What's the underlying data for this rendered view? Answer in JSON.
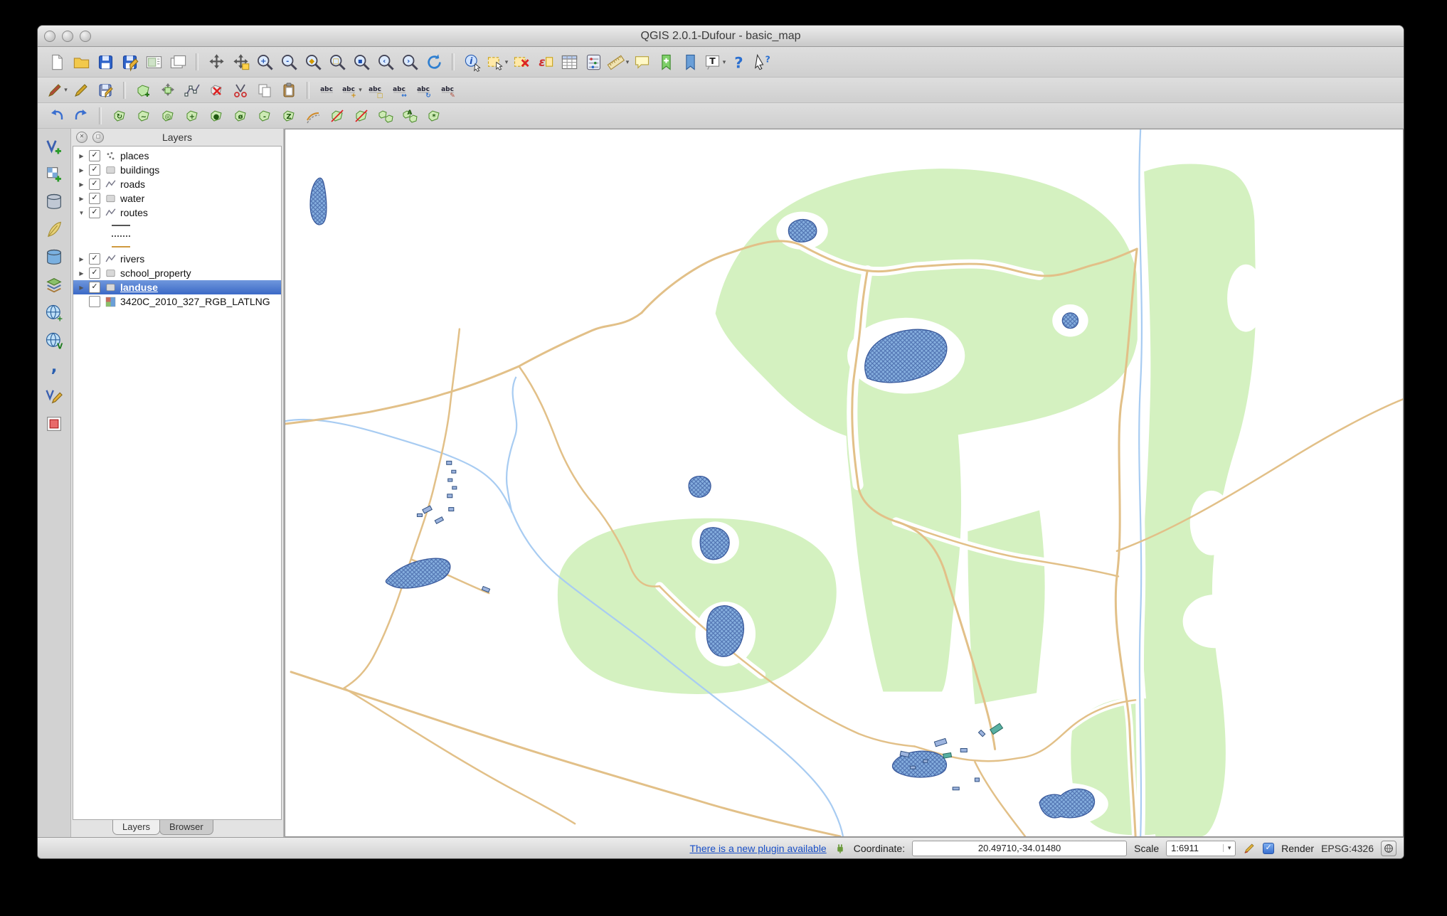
{
  "window": {
    "title": "QGIS 2.0.1-Dufour - basic_map",
    "buttons": [
      "close-button",
      "minimize-button",
      "zoom-button"
    ]
  },
  "colors": {
    "sel": "#3b69c6",
    "link": "#1a50c8",
    "landuse": "#d4f1c0",
    "water": "#85aede",
    "waterline": "#3a5a9c",
    "road": "#e2c088",
    "river": "#a8ccf2",
    "bld": "#9db4de",
    "bldline": "#2f4f7f",
    "school": "#58b0a2"
  },
  "toolbars": {
    "row1": [
      {
        "name": "new-project",
        "k": "page"
      },
      {
        "name": "open-project",
        "k": "folder"
      },
      {
        "name": "save-project",
        "k": "floppy"
      },
      {
        "name": "save-project-as",
        "k": "floppyPen"
      },
      {
        "name": "new-print-composer",
        "k": "composer"
      },
      {
        "name": "composer-manager",
        "k": "composerMgr"
      },
      {
        "sep": true
      },
      {
        "name": "pan-map",
        "k": "pan"
      },
      {
        "name": "pan-map-to-selection",
        "k": "panSel"
      },
      {
        "name": "zoom-in",
        "k": "mag",
        "b": "+"
      },
      {
        "name": "zoom-out",
        "k": "mag",
        "b": "-"
      },
      {
        "name": "zoom-full",
        "k": "mag",
        "b": "◆",
        "c": "#d29a00"
      },
      {
        "name": "zoom-to-selection",
        "k": "mag",
        "b": "□",
        "c": "#d29a00"
      },
      {
        "name": "zoom-to-layer",
        "k": "mag",
        "b": "▪"
      },
      {
        "name": "zoom-last",
        "k": "mag",
        "b": "‹"
      },
      {
        "name": "zoom-next",
        "k": "mag",
        "b": "›"
      },
      {
        "name": "refresh-map",
        "k": "refresh"
      },
      {
        "sep": true
      },
      {
        "name": "identify-features",
        "k": "identify"
      },
      {
        "name": "select-features",
        "k": "select",
        "dd": true
      },
      {
        "name": "deselect-all",
        "k": "deselect"
      },
      {
        "name": "select-by-expression",
        "k": "expr"
      },
      {
        "name": "open-attribute-table",
        "k": "table"
      },
      {
        "name": "field-calculator",
        "k": "calc"
      },
      {
        "name": "measure-line",
        "k": "ruler",
        "dd": true
      },
      {
        "name": "map-tips",
        "k": "bubble"
      },
      {
        "name": "new-bookmark",
        "k": "bmAdd"
      },
      {
        "name": "show-bookmarks",
        "k": "bmShow"
      },
      {
        "name": "text-annotation",
        "k": "annoT",
        "dd": true
      },
      {
        "name": "help-contents",
        "k": "help"
      },
      {
        "name": "whats-this",
        "k": "whatsThis"
      }
    ],
    "row2": [
      {
        "name": "current-edits",
        "k": "pen",
        "c": "#b04a3a",
        "dd": true
      },
      {
        "name": "toggle-editing",
        "k": "pen",
        "c": "#d2a62a"
      },
      {
        "name": "save-layer-edits",
        "k": "penSave"
      },
      {
        "sep": true
      },
      {
        "name": "add-feature",
        "k": "featAdd"
      },
      {
        "name": "move-feature",
        "k": "moveFeat"
      },
      {
        "name": "node-tool",
        "k": "nodeTool"
      },
      {
        "name": "delete-selected",
        "k": "delSel"
      },
      {
        "name": "cut-features",
        "k": "cut"
      },
      {
        "name": "copy-features",
        "k": "copy"
      },
      {
        "name": "paste-features",
        "k": "paste"
      },
      {
        "sep": true
      },
      {
        "name": "labeling-options",
        "k": "abc"
      },
      {
        "name": "pin-labels",
        "k": "abc",
        "b": "+",
        "dd": true
      },
      {
        "name": "highlight-pinned-labels",
        "k": "abc",
        "b": "□",
        "c": "#caa41a"
      },
      {
        "name": "move-label",
        "k": "abc",
        "b": "↔",
        "c": "#2a6fd0"
      },
      {
        "name": "rotate-label",
        "k": "abc",
        "b": "↻",
        "c": "#2a6fd0"
      },
      {
        "name": "change-label-properties",
        "k": "abc",
        "b": "✎",
        "c": "#b04a3a"
      }
    ],
    "row3": [
      {
        "name": "undo",
        "k": "undo"
      },
      {
        "name": "redo",
        "k": "redo"
      },
      {
        "sep": true
      },
      {
        "name": "rotate-feature",
        "k": "gpoly",
        "b": "↻"
      },
      {
        "name": "simplify-feature",
        "k": "gpoly",
        "b": "~"
      },
      {
        "name": "add-ring",
        "k": "gpoly",
        "b": "◎"
      },
      {
        "name": "add-part",
        "k": "gpoly",
        "b": "+"
      },
      {
        "name": "fill-ring",
        "k": "gpoly",
        "b": "●"
      },
      {
        "name": "delete-ring",
        "k": "gpoly",
        "b": "ø"
      },
      {
        "name": "delete-part",
        "k": "gpoly",
        "b": "-"
      },
      {
        "name": "reshape-features",
        "k": "gpoly",
        "b": "Z"
      },
      {
        "name": "offset-curve",
        "k": "offset"
      },
      {
        "name": "split-features",
        "k": "splitF"
      },
      {
        "name": "split-parts",
        "k": "splitF"
      },
      {
        "name": "merge-features",
        "k": "merge"
      },
      {
        "name": "merge-attributes",
        "k": "merge",
        "b": "A"
      },
      {
        "name": "rotate-point-symbols",
        "k": "gpoly",
        "b": "*"
      }
    ],
    "rail": [
      {
        "name": "add-vector-layer",
        "k": "vlayer"
      },
      {
        "name": "add-raster-layer",
        "k": "rlayer"
      },
      {
        "name": "add-postgis-layer",
        "k": "dbcyl",
        "c": "#c0c8d4"
      },
      {
        "name": "add-spatialite-layer",
        "k": "feather"
      },
      {
        "name": "add-mssql-layer",
        "k": "dbcyl",
        "c": "#7ab0e0"
      },
      {
        "name": "add-wms-layer",
        "k": "layers"
      },
      {
        "name": "add-wcs-layer",
        "k": "globe",
        "b": "+"
      },
      {
        "name": "add-wfs-layer",
        "k": "globe",
        "b": "V"
      },
      {
        "name": "add-delimited-text-layer",
        "k": "comma"
      },
      {
        "name": "new-shapefile-layer",
        "k": "vpen"
      },
      {
        "name": "remove-layer",
        "k": "removeSq"
      }
    ]
  },
  "layers_panel": {
    "title": "Layers",
    "layers": [
      {
        "label": "places",
        "type": "point",
        "checked": true,
        "expanded": false
      },
      {
        "label": "buildings",
        "type": "polygon",
        "checked": true,
        "expanded": false
      },
      {
        "label": "roads",
        "type": "line",
        "checked": true,
        "expanded": false
      },
      {
        "label": "water",
        "type": "polygon",
        "checked": true,
        "expanded": false
      },
      {
        "label": "routes",
        "type": "line",
        "checked": true,
        "expanded": true,
        "legend": [
          "line-solid",
          "line-dotted",
          "line-tan"
        ]
      },
      {
        "label": "rivers",
        "type": "line",
        "checked": true,
        "expanded": false
      },
      {
        "label": "school_property",
        "type": "polygon",
        "checked": true,
        "expanded": false
      },
      {
        "label": "landuse",
        "type": "polygon",
        "checked": true,
        "expanded": false,
        "selected": true
      },
      {
        "label": "3420C_2010_327_RGB_LATLNG",
        "type": "raster",
        "checked": false,
        "expanded": false,
        "arrow": false
      }
    ],
    "tabs": [
      {
        "label": "Layers",
        "active": true
      },
      {
        "label": "Browser",
        "active": false
      }
    ]
  },
  "status_bar": {
    "plugin_link": "There is a new plugin available",
    "coordinate_label": "Coordinate:",
    "coordinate_value": "20.49710,-34.01480",
    "scale_label": "Scale",
    "scale_value": "1:6911",
    "render_label": "Render",
    "render_checked": true,
    "crs_text": "EPSG:4326",
    "icons": [
      "plugin-icon",
      "map-pen-icon",
      "crs-status-icon",
      "dropdown-arrow-icon"
    ]
  }
}
